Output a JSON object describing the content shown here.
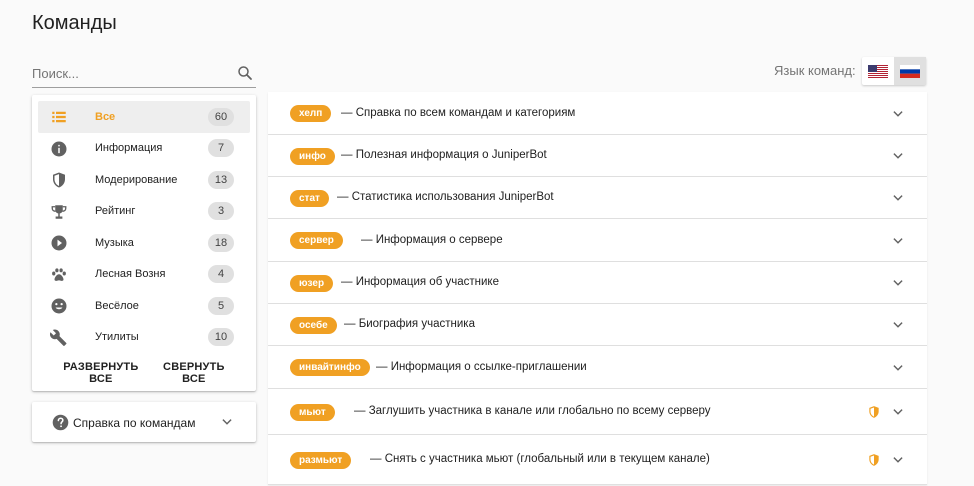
{
  "header": {
    "title": "Команды"
  },
  "search": {
    "placeholder": "Поиск..."
  },
  "categories": [
    {
      "label": "Все",
      "count": "60",
      "icon": "list-icon",
      "active": true
    },
    {
      "label": "Информация",
      "count": "7",
      "icon": "info-icon"
    },
    {
      "label": "Модерирование",
      "count": "13",
      "icon": "shield-icon"
    },
    {
      "label": "Рейтинг",
      "count": "3",
      "icon": "trophy-icon"
    },
    {
      "label": "Музыка",
      "count": "18",
      "icon": "play-circle-icon"
    },
    {
      "label": "Лесная Возня",
      "count": "4",
      "icon": "paw-icon"
    },
    {
      "label": "Весёлое",
      "count": "5",
      "icon": "smile-icon"
    },
    {
      "label": "Утилиты",
      "count": "10",
      "icon": "wrench-icon"
    }
  ],
  "category_actions": {
    "expand_all": "РАЗВЕРНУТЬ ВСЕ",
    "collapse_all": "СВЕРНУТЬ ВСЕ"
  },
  "help_panel": {
    "label": "Справка по командам"
  },
  "language": {
    "label": "Язык команд:",
    "options": [
      "us-flag-icon",
      "ru-flag-icon"
    ],
    "selected": "ru-flag-icon"
  },
  "commands": [
    {
      "name": "хелп",
      "desc": "— Справка по всем командам и категориям",
      "restricted": false
    },
    {
      "name": "инфо",
      "desc": "— Полезная информация о JuniperBot",
      "restricted": false
    },
    {
      "name": "стат",
      "desc": "— Статистика использования JuniperBot",
      "restricted": false
    },
    {
      "name": "сервер",
      "desc": "— Информация о сервере",
      "restricted": false
    },
    {
      "name": "юзер",
      "desc": "— Информация об участнике",
      "restricted": false
    },
    {
      "name": "осебе",
      "desc": "— Биография участника",
      "restricted": false
    },
    {
      "name": "инвайтинфо",
      "desc": "— Информация о ссылке-приглашении",
      "restricted": false
    },
    {
      "name": "мьют",
      "desc": "— Заглушить участника в канале или глобально по всему серверу",
      "restricted": true
    },
    {
      "name": "размьют",
      "desc": "— Снять с участника мьют (глобальный или в текущем канале)",
      "restricted": true
    }
  ],
  "colors": {
    "accent": "#f0a023",
    "icon": "#616161"
  }
}
